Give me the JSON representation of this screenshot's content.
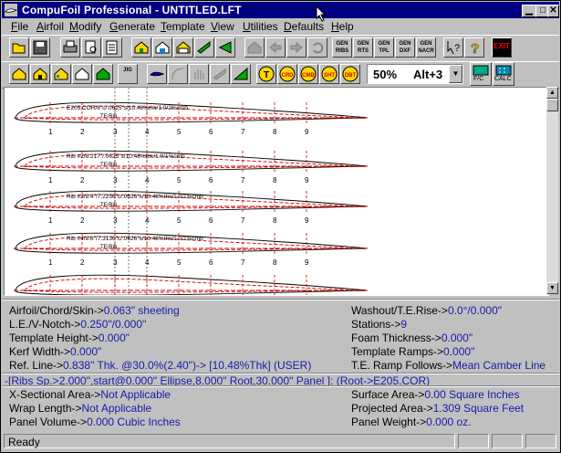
{
  "window": {
    "title": "CompuFoil Professional - UNTITLED.LFT"
  },
  "menu": [
    {
      "label": "File",
      "underline": "F"
    },
    {
      "label": "Airfoil",
      "underline": "A"
    },
    {
      "label": "Modify",
      "underline": "M"
    },
    {
      "label": "Generate",
      "underline": "G"
    },
    {
      "label": "Template",
      "underline": "T"
    },
    {
      "label": "View",
      "underline": "V"
    },
    {
      "label": "Utilities",
      "underline": "U"
    },
    {
      "label": "Defaults",
      "underline": "D"
    },
    {
      "label": "Help",
      "underline": "H"
    }
  ],
  "toolbar": {
    "gen_ribs": "GEN RIBS",
    "gen_rts": "GEN RTS",
    "gen_tpl": "GEN TPL",
    "gen_dxf": "GEN DXF",
    "gen_nacr": "GEN NACR",
    "exit": "EXIT",
    "bt1": "T",
    "bt2": "CRD",
    "bt3": "CMB",
    "bt4": "SHT",
    "bt5": "DBT",
    "zoom_value": "50%",
    "zoom_key": "Alt+3",
    "fc_label": "F/C",
    "calc_label": "CALC"
  },
  "ribs": [
    {
      "label": "E205.COR/8\"c/.0625\"s/10.48%thk/1.0/2%cmb",
      "sub": "TE/Rib"
    },
    {
      "label": "Rib #2/8.217\"/.0625\"s/10.48%thk/1.0/1%cmb",
      "sub": "TE/Rib"
    },
    {
      "label": "Rib #3/8.4\"/7.2256\"c/.0626\"s/10.48%thk/1.0/1%cmb",
      "sub": "TE/Rib"
    },
    {
      "label": "Rib #4/8.6\"/7.3136\"c/.0626\"s/10.48%thk/1.0/1%cmb",
      "sub": "TE/Rib"
    }
  ],
  "stations": [
    "1",
    "2",
    "3",
    "4",
    "5",
    "6",
    "7",
    "8",
    "9"
  ],
  "info": {
    "airfoil_label": "Airfoil/Chord/Skin->",
    "airfoil_value": "0.063\" sheeting",
    "le_label": "L.E./V-Notch->",
    "le_value": "0.250\"/0.000\"",
    "template_label": "Template Height->",
    "template_value": "0.000\"",
    "kerf_label": "Kerf Width->",
    "kerf_value": "0.000\"",
    "ref_label": "Ref. Line->",
    "ref_value": "0.838\" Thk. @30.0%(2.40\")-> [10.48%Thk] (USER)",
    "washout_label": "Washout/T.E.Rise->",
    "washout_value": "0.0°/0.000\"",
    "stations_label": "Stations->",
    "stations_value": "9",
    "foam_label": "Foam Thickness->",
    "foam_value": "0.000\"",
    "ramps_label": "Template Ramps->",
    "ramps_value": "0.000\"",
    "teramp_label": "T.E. Ramp Follows->",
    "teramp_value": "Mean Camber Line",
    "rib_spec": "-[Ribs Sp.>2.000\",start@0.000\" Ellipse,8.000\" Root,30.000\" Panel ]: (Root->E205.COR)",
    "xsec_label": "X-Sectional Area->",
    "xsec_value": "Not Applicable",
    "wrap_label": "Wrap Length->",
    "wrap_value": "Not Applicable",
    "volume_label": "Panel Volume->",
    "volume_value": "0.000 Cubic Inches",
    "surface_label": "Surface Area->",
    "surface_value": "0.00 Square Inches",
    "projected_label": "Projected Area->",
    "projected_value": "1.309 Square Feet",
    "weight_label": "Panel Weight->",
    "weight_value": "0.000 oz."
  },
  "status": {
    "text": "Ready"
  },
  "colors": {
    "title_bg": "#000080",
    "value_text": "#1a1aa8",
    "rib_red": "#cc0000",
    "panel": "#c0c0c0"
  }
}
